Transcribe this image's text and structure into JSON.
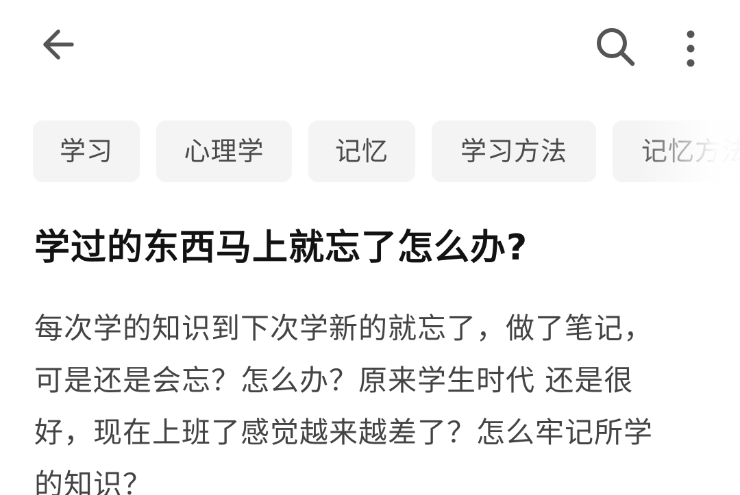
{
  "header": {
    "back_icon": "arrow-left-icon",
    "search_icon": "search-icon",
    "more_icon": "more-vertical-icon",
    "icon_color": "#555555"
  },
  "tags": [
    {
      "label": "学习"
    },
    {
      "label": "心理学"
    },
    {
      "label": "记忆"
    },
    {
      "label": "学习方法"
    },
    {
      "label": "记忆方法"
    }
  ],
  "question": {
    "title": "学过的东西马上就忘了怎么办?",
    "description_lines": [
      "每次学的知识到下次学新的就忘了，做了笔记，",
      "可是还是会忘？怎么办？原来学生时代 还是很",
      "好，现在上班了感觉越来越差了？怎么牢记所学",
      "的知识？"
    ]
  }
}
